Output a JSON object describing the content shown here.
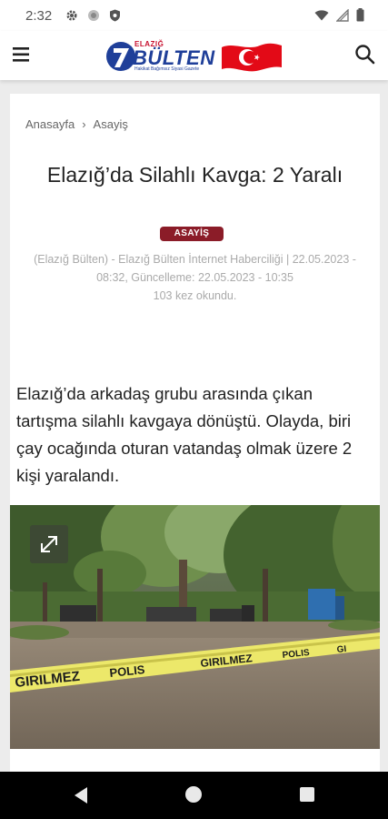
{
  "status_bar": {
    "time": "2:32",
    "left_icons": [
      "gear-icon",
      "circle-notification-icon",
      "shield-icon"
    ],
    "right_icons": [
      "wifi-icon",
      "signal-icon",
      "battery-icon"
    ]
  },
  "header": {
    "logo": {
      "top_text": "ELAZIĞ",
      "main_text": "BÜLTEN",
      "tagline": "Hakikat Bağımsız Siyasi Gazete"
    },
    "colors": {
      "brand_blue": "#1f3f99",
      "brand_red": "#e30a17"
    }
  },
  "article": {
    "breadcrumb": {
      "home": "Anasayfa",
      "separator": "›",
      "section": "Asayiş"
    },
    "title": "Elazığ’da Silahlı Kavga: 2 Yaralı",
    "category": "ASAYİŞ",
    "category_color": "#8b1c28",
    "meta": "(Elazığ Bülten) - Elazığ Bülten İnternet Haberciliği | 22.05.2023 - 08:32, Güncelleme: 22.05.2023 - 10:35",
    "views": "103 kez okundu.",
    "lead": "Elazığ’da arkadaş grubu arasında çıkan tartışma silahlı kavgaya dönüştü. Olayda, biri çay ocağında oturan vatandaş olmak üzere 2 kişi yaralandı.",
    "image": {
      "tape_text_1": "GIRILMEZ",
      "tape_text_2": "POLIS",
      "tape_text_3": "GIRILMEZ",
      "tape_text_4": "POLIS",
      "tape_text_5": "GI"
    }
  },
  "nav_bar": {
    "icons": [
      "back-icon",
      "home-icon",
      "recents-icon"
    ]
  }
}
